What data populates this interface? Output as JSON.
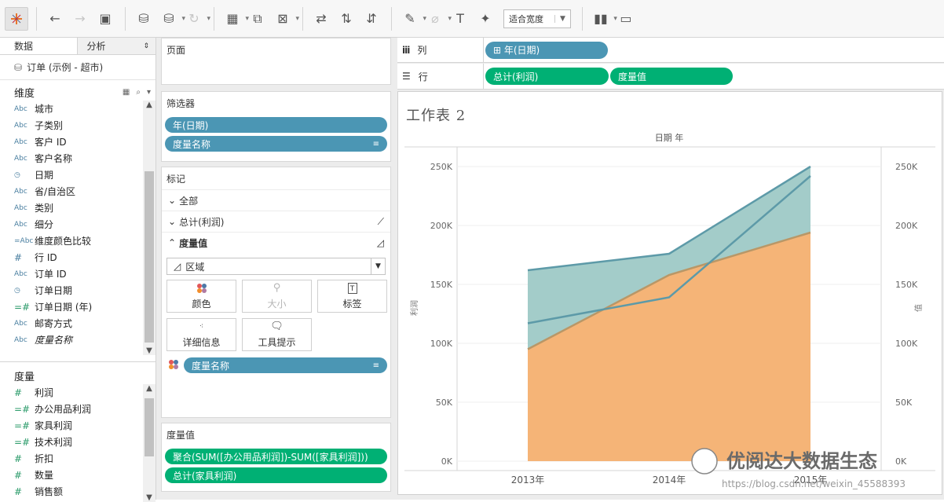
{
  "toolbar": {
    "fit_label": "适合宽度"
  },
  "left_pane": {
    "tab_data": "数据",
    "tab_analysis": "分析",
    "datasource": "订单 (示例 - 超市)",
    "dimensions_title": "维度",
    "dimensions": [
      {
        "icon": "Abc",
        "label": "城市"
      },
      {
        "icon": "Abc",
        "label": "子类别"
      },
      {
        "icon": "Abc",
        "label": "客户 ID"
      },
      {
        "icon": "Abc",
        "label": "客户名称"
      },
      {
        "icon": "date",
        "label": "日期"
      },
      {
        "icon": "Abc",
        "label": "省/自治区"
      },
      {
        "icon": "Abc",
        "label": "类别"
      },
      {
        "icon": "Abc",
        "label": "细分"
      },
      {
        "icon": "=Abc",
        "label": "维度颜色比较"
      },
      {
        "icon": "#",
        "label": "行 ID"
      },
      {
        "icon": "Abc",
        "label": "订单 ID"
      },
      {
        "icon": "date",
        "label": "订单日期"
      },
      {
        "icon": "=#",
        "label": "订单日期 (年)"
      },
      {
        "icon": "Abc",
        "label": "邮寄方式"
      },
      {
        "icon": "Abc",
        "label": "度量名称"
      }
    ],
    "measures_title": "度量",
    "measures": [
      {
        "icon": "#",
        "label": "利润"
      },
      {
        "icon": "=#",
        "label": "办公用品利润"
      },
      {
        "icon": "=#",
        "label": "家具利润"
      },
      {
        "icon": "=#",
        "label": "技术利润"
      },
      {
        "icon": "#",
        "label": "折扣"
      },
      {
        "icon": "#",
        "label": "数量"
      },
      {
        "icon": "#",
        "label": "销售额"
      }
    ]
  },
  "pages": {
    "title": "页面"
  },
  "filters": {
    "title": "筛选器",
    "items": [
      "年(日期)",
      "度量名称"
    ]
  },
  "marks": {
    "title": "标记",
    "rows": [
      {
        "label": "全部"
      },
      {
        "label": "总计(利润)"
      },
      {
        "label": "度量值"
      }
    ],
    "mark_type": "区域",
    "buttons": {
      "color": "颜色",
      "size": "大小",
      "label": "标签",
      "detail": "详细信息",
      "tooltip": "工具提示"
    },
    "color_pill": "度量名称"
  },
  "measure_values": {
    "title": "度量值",
    "items": [
      "聚合(SUM([办公用品利润])-SUM([家具利润]))",
      "总计(家具利润)"
    ]
  },
  "columns_shelf": {
    "label": "列",
    "pills": [
      "⊞ 年(日期)"
    ]
  },
  "rows_shelf": {
    "label": "行",
    "pills": [
      "总计(利润)",
      "度量值"
    ]
  },
  "sheet": {
    "title": "工作表 2"
  },
  "watermark": {
    "brand": "优阅达大数据生态",
    "url": "https://blog.csdn.net/weixin_45588393"
  },
  "chart_data": {
    "type": "area",
    "title": "工作表 2",
    "column_header": "日期 年",
    "x": [
      "2013年",
      "2014年",
      "2015年"
    ],
    "left_axis": {
      "label": "利润",
      "ticks": [
        "0K",
        "50K",
        "100K",
        "150K",
        "200K",
        "250K"
      ],
      "ylim": [
        0,
        260000
      ]
    },
    "right_axis": {
      "label": "值",
      "ticks": [
        "0K",
        "50K",
        "100K",
        "150K",
        "200K",
        "250K"
      ],
      "ylim": [
        0,
        260000
      ]
    },
    "series": [
      {
        "values": [
          162000,
          176000,
          250000
        ],
        "color": "#a3ccc9",
        "line": "#5d9aa8",
        "kind": "area"
      },
      {
        "values": [
          95000,
          158000,
          194000
        ],
        "color": "#f5b477",
        "line": "#b99767",
        "kind": "area"
      },
      {
        "values": [
          117000,
          139000,
          242000
        ],
        "color": "none",
        "line": "#5d9aa8",
        "kind": "line"
      }
    ],
    "grid": true
  }
}
